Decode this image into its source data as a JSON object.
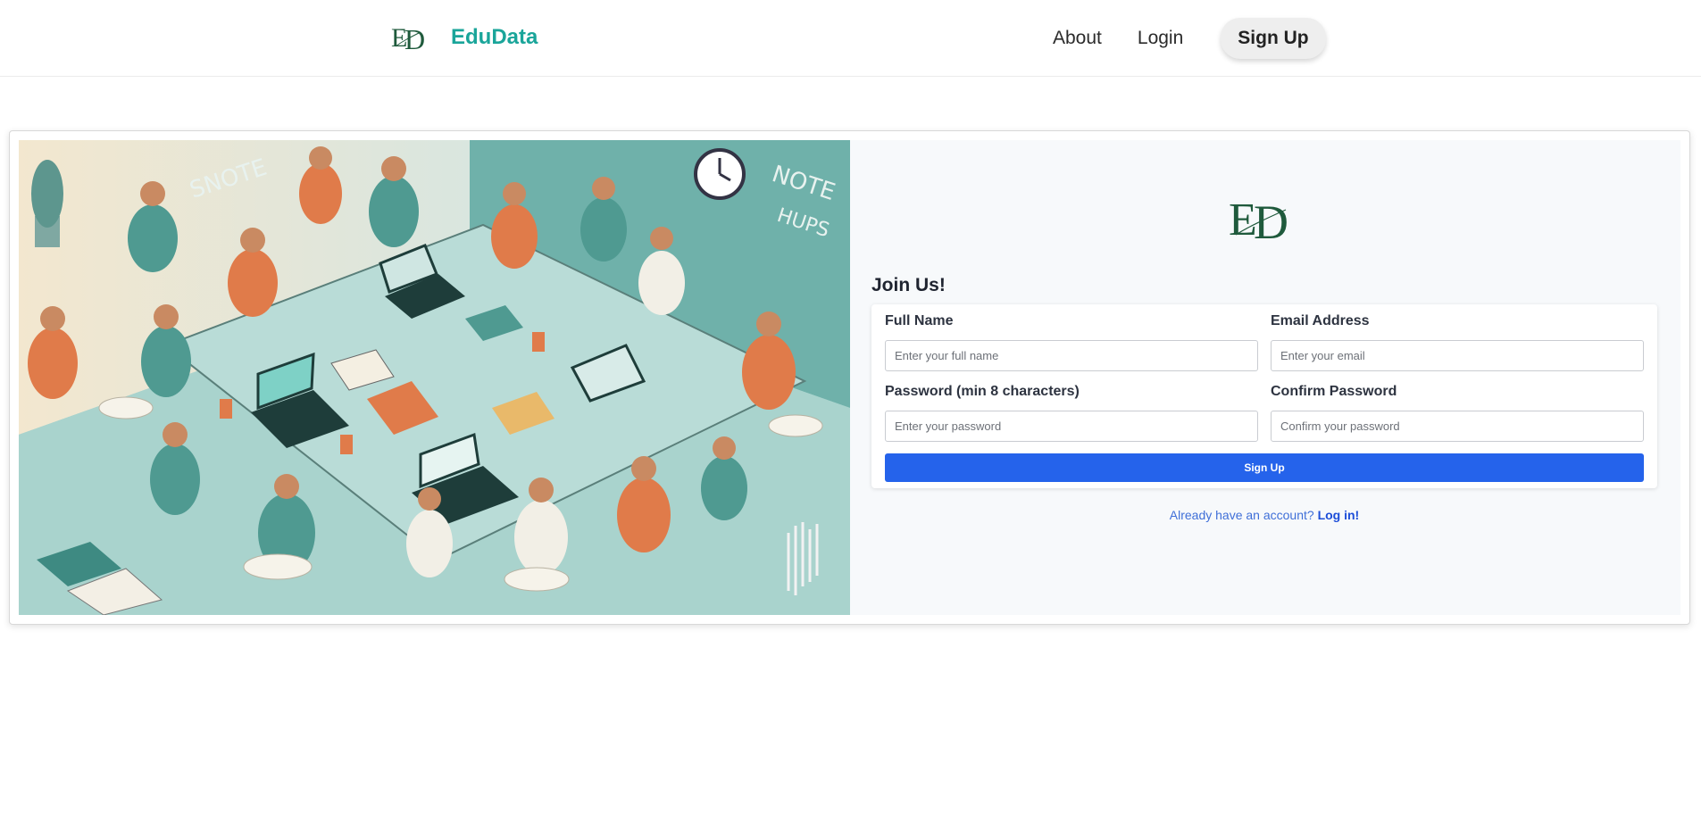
{
  "header": {
    "brand_name": "EduData",
    "nav": {
      "about": "About",
      "login": "Login",
      "signup": "Sign Up"
    }
  },
  "signup_form": {
    "title": "Join Us!",
    "fields": {
      "full_name": {
        "label": "Full Name",
        "placeholder": "Enter your full name",
        "value": ""
      },
      "email": {
        "label": "Email Address",
        "placeholder": "Enter your email",
        "value": ""
      },
      "password": {
        "label": "Password (min 8 characters)",
        "placeholder": "Enter your password",
        "value": ""
      },
      "confirm_password": {
        "label": "Confirm Password",
        "placeholder": "Confirm your password",
        "value": ""
      }
    },
    "submit_label": "Sign Up",
    "login_prompt": "Already have an account?",
    "login_link": "Log in!"
  },
  "colors": {
    "brand": "#1aa59a",
    "primary_button": "#2563eb",
    "link": "#1d4ed8",
    "illustration_teal": "#5fa7a0",
    "illustration_orange": "#e07b4a"
  },
  "icons": {
    "logo": "edudata-logo-monogram"
  }
}
